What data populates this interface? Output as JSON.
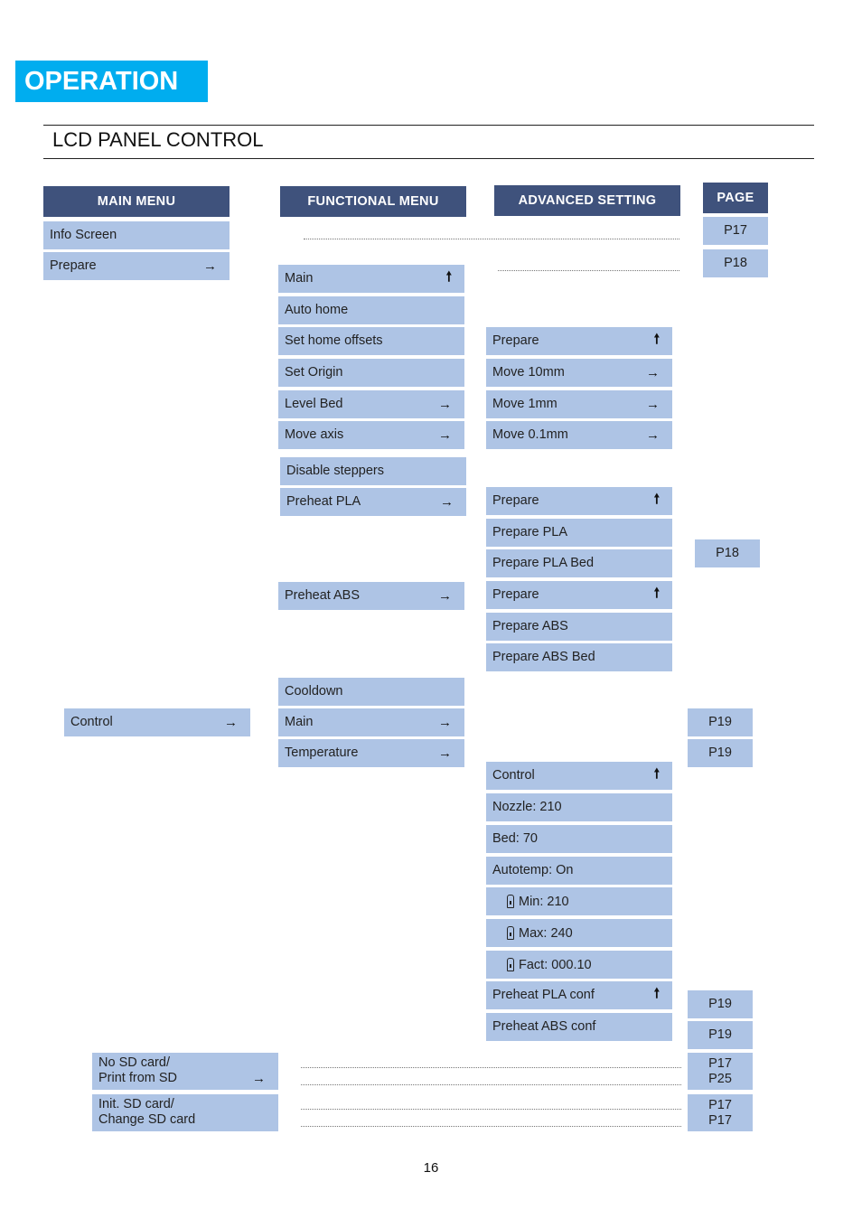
{
  "banner": "OPERATION",
  "section_title": "LCD PANEL CONTROL",
  "headers": {
    "main_menu": "MAIN MENU",
    "functional_menu": "FUNCTIONAL MENU",
    "advanced_setting": "ADVANCED SETTING",
    "page": "PAGE"
  },
  "main_menu": {
    "info_screen": "Info Screen",
    "prepare": "Prepare",
    "control": "Control",
    "print_from_sd": "No SD card/\nPrint from SD",
    "change_sd": "Init. SD card/\nChange SD card"
  },
  "functional_menu": {
    "main": "Main",
    "auto_home": "Auto home",
    "set_home_offsets": "Set home offsets",
    "set_origin": "Set Origin",
    "level_bed": "Level Bed",
    "move_axis": "Move axis",
    "disable_steppers": "Disable steppers",
    "preheat_pla": "Preheat PLA",
    "preheat_abs": "Preheat ABS",
    "cooldown": "Cooldown",
    "control_main": "Main",
    "temperature": "Temperature"
  },
  "advanced_setting": {
    "move_prepare": "Prepare",
    "move_10mm": "Move 10mm",
    "move_1mm": "Move 1mm",
    "move_01mm": "Move 0.1mm",
    "pla_prepare": "Prepare",
    "prepare_pla": "Prepare PLA",
    "prepare_pla_bed": "Prepare PLA Bed",
    "abs_prepare": "Prepare",
    "prepare_abs": "Prepare ABS",
    "prepare_abs_bed": "Prepare ABS Bed",
    "temp_control": "Control",
    "nozzle": "Nozzle: 210",
    "bed": "Bed: 70",
    "autotemp": "Autotemp: On",
    "min": "Min: 210",
    "max": "Max: 240",
    "fact": "Fact: 000.10",
    "preheat_pla_conf": "Preheat PLA conf",
    "preheat_abs_conf": "Preheat ABS conf"
  },
  "pages": {
    "info_screen": "P17",
    "prepare": "P18",
    "preheat": "P18",
    "control_main": "P19",
    "temperature": "P19",
    "preheat_pla_conf": "P19",
    "preheat_abs_conf": "P19",
    "print_from_sd": "P17\nP25",
    "change_sd": "P17\nP17"
  },
  "icons": {
    "arrow_right": "→",
    "arrow_up": "🠕"
  },
  "page_number": "16",
  "colors": {
    "banner": "#00adef",
    "header": "#3f527c",
    "item": "#aec4e5"
  }
}
